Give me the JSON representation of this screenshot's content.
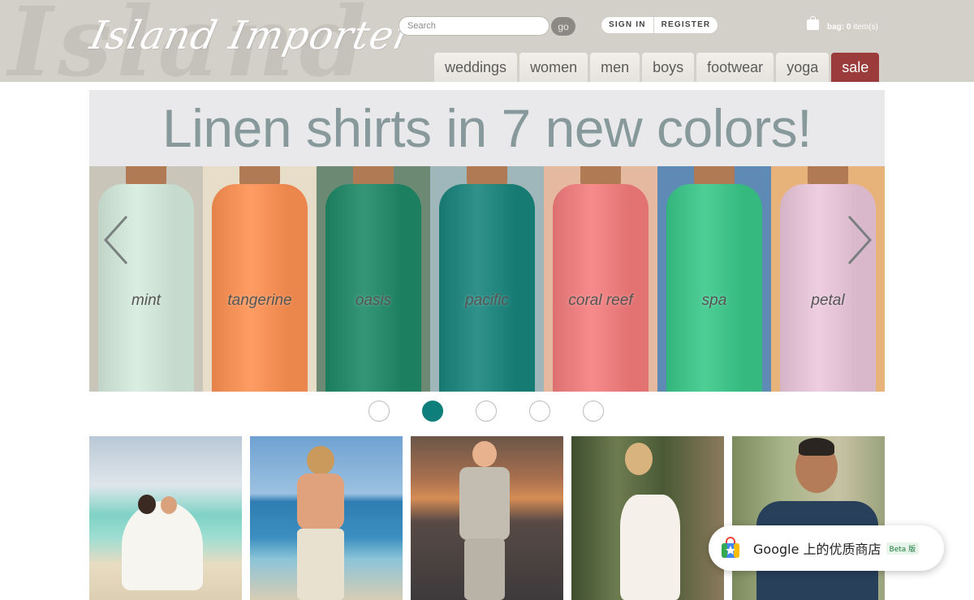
{
  "header": {
    "logo_text": "Island Importer",
    "bg_script": "Island",
    "search": {
      "placeholder": "Search",
      "value": ""
    },
    "go_label": "go",
    "sign_in": "SIGN IN",
    "register": "REGISTER",
    "bag_label": "bag: ",
    "bag_count": "0",
    "bag_suffix": " item(s)"
  },
  "nav": {
    "weddings": "weddings",
    "women": "women",
    "men": "men",
    "boys": "boys",
    "footwear": "footwear",
    "yoga": "yoga",
    "sale": "sale"
  },
  "hero": {
    "title": "Linen shirts in 7 new colors!",
    "colors": [
      {
        "label": "mint",
        "shirt": "#d7ecdf",
        "bg": "#c9c6b9"
      },
      {
        "label": "tangerine",
        "shirt": "#ff9152",
        "bg": "#e7ddc9"
      },
      {
        "label": "oasis",
        "shirt": "#1e8a67",
        "bg": "#6c8a73"
      },
      {
        "label": "pacific",
        "shirt": "#18857d",
        "bg": "#9fb7ba"
      },
      {
        "label": "coral reef",
        "shirt": "#f67d7d",
        "bg": "#e5b9a0"
      },
      {
        "label": "spa",
        "shirt": "#39c98a",
        "bg": "#5f8ab5"
      },
      {
        "label": "petal",
        "shirt": "#ecc8dd",
        "bg": "#e7b37a"
      }
    ],
    "active_slide": 2,
    "slide_count": 5
  },
  "toast": {
    "text": "Google 上的优质商店",
    "badge": "Beta 版"
  }
}
